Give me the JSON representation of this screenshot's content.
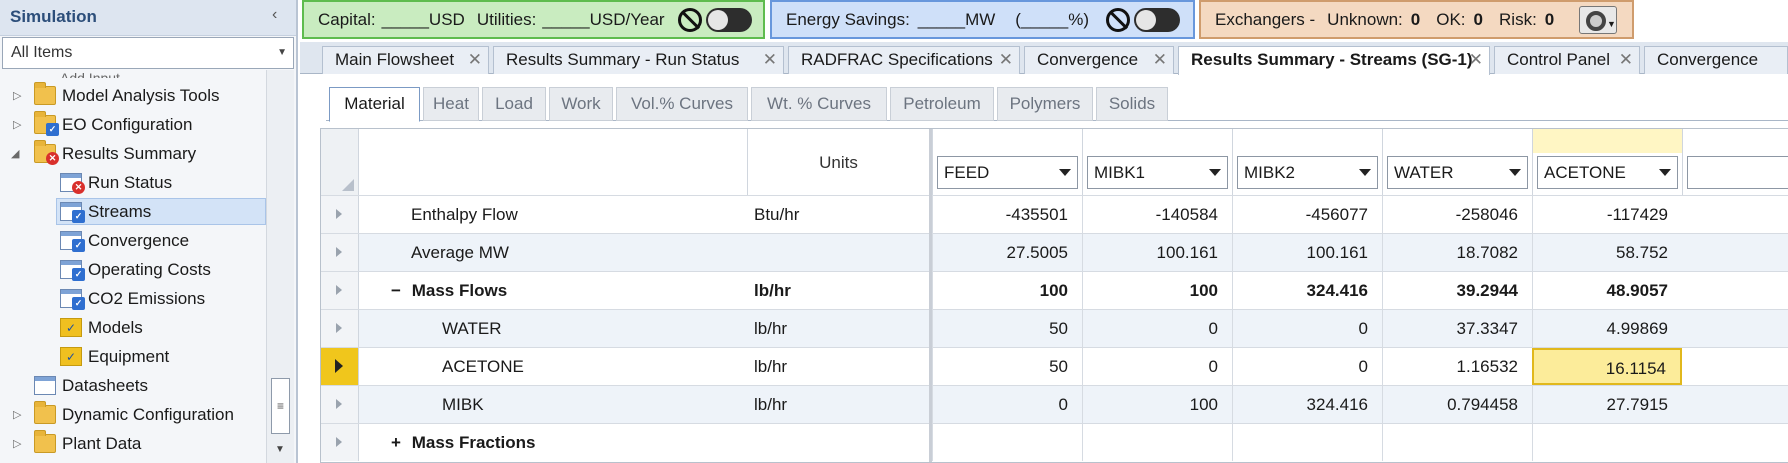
{
  "sidebar": {
    "title": "Simulation",
    "collapse_glyph": "‹",
    "filter_value": "All Items",
    "cut_item": "Add Input",
    "items": [
      {
        "label": "Model Analysis Tools",
        "icon": "folder-icon"
      },
      {
        "label": "EO Configuration",
        "icon": "folder-check-icon"
      },
      {
        "label": "Results Summary",
        "icon": "folder-error-icon"
      },
      {
        "label": "Run Status",
        "icon": "form-error-icon"
      },
      {
        "label": "Streams",
        "icon": "form-check-icon"
      },
      {
        "label": "Convergence",
        "icon": "form-check-icon"
      },
      {
        "label": "Operating Costs",
        "icon": "form-check-icon"
      },
      {
        "label": "CO2 Emissions",
        "icon": "form-check-icon"
      },
      {
        "label": "Models",
        "icon": "check-icon"
      },
      {
        "label": "Equipment",
        "icon": "check-icon"
      },
      {
        "label": "Datasheets",
        "icon": "datasheet-icon"
      },
      {
        "label": "Dynamic Configuration",
        "icon": "folder-icon"
      },
      {
        "label": "Plant Data",
        "icon": "folder-icon"
      }
    ]
  },
  "panels": {
    "capital": {
      "label": "Capital:",
      "unit1": "_____USD",
      "utilities_label": "Utilities:",
      "unit2": "_____USD/Year"
    },
    "energy": {
      "label": "Energy Savings:",
      "unit": "_____MW",
      "pct": "(_____%)"
    },
    "exchangers": {
      "label": "Exchangers -",
      "unknown_label": "Unknown:",
      "unknown": "0",
      "ok_label": "OK:",
      "ok": "0",
      "risk_label": "Risk:",
      "risk": "0"
    }
  },
  "tabs": [
    "Main Flowsheet",
    "Results Summary - Run Status",
    "RADFRAC Specifications",
    "Convergence",
    "Results Summary - Streams (SG-1)",
    "Control Panel",
    "Convergence"
  ],
  "subtabs": [
    "Material",
    "Heat",
    "Load",
    "Work",
    "Vol.% Curves",
    "Wt. % Curves",
    "Petroleum",
    "Polymers",
    "Solids"
  ],
  "grid": {
    "units_header": "Units",
    "columns": [
      "FEED",
      "MIBK1",
      "MIBK2",
      "WATER",
      "ACETONE"
    ],
    "rows": [
      {
        "label": "Enthalpy Flow",
        "units": "Btu/hr",
        "values": [
          "-435501",
          "-140584",
          "-456077",
          "-258046",
          "-117429"
        ]
      },
      {
        "label": "Average MW",
        "units": "",
        "values": [
          "27.5005",
          "100.161",
          "100.161",
          "18.7082",
          "58.752"
        ]
      },
      {
        "label": "Mass Flows",
        "sign": "−",
        "units": "lb/hr",
        "values": [
          "100",
          "100",
          "324.416",
          "39.2944",
          "48.9057"
        ]
      },
      {
        "label": "WATER",
        "units": "lb/hr",
        "values": [
          "50",
          "0",
          "0",
          "37.3347",
          "4.99869"
        ]
      },
      {
        "label": "ACETONE",
        "units": "lb/hr",
        "values": [
          "50",
          "0",
          "0",
          "1.16532",
          "16.1154"
        ]
      },
      {
        "label": "MIBK",
        "units": "lb/hr",
        "values": [
          "0",
          "100",
          "324.416",
          "0.794458",
          "27.7915"
        ]
      },
      {
        "label": "Mass Fractions",
        "sign": "+",
        "units": "",
        "values": [
          "",
          "",
          "",
          "",
          ""
        ]
      }
    ]
  }
}
